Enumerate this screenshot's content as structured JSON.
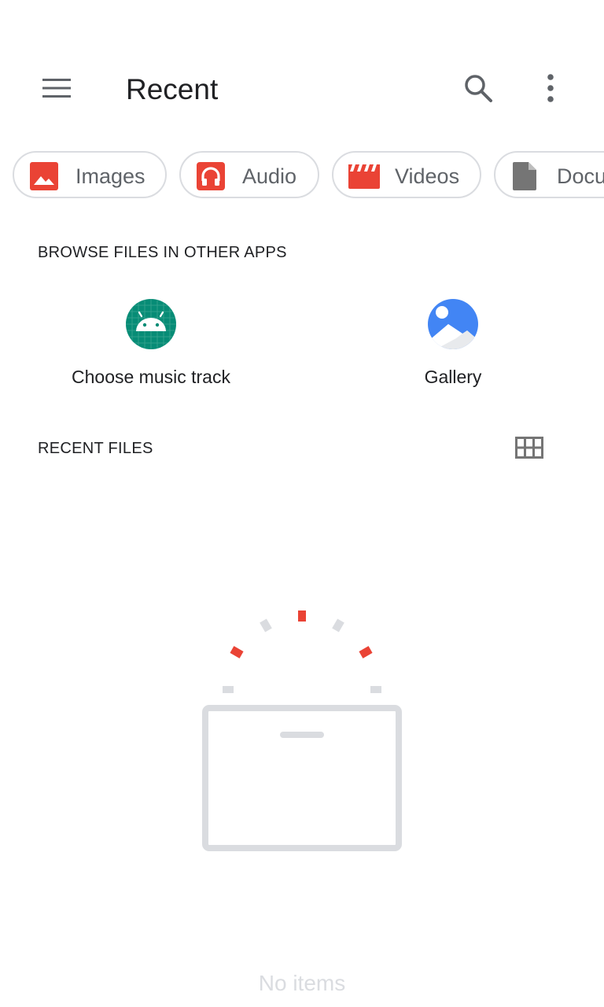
{
  "appbar": {
    "title": "Recent",
    "menu_icon": "hamburger-menu-icon",
    "search_icon": "search-icon",
    "more_icon": "more-vert-icon"
  },
  "chips": [
    {
      "label": "Images",
      "icon": "image-icon",
      "color": "#ea4335"
    },
    {
      "label": "Audio",
      "icon": "headphones-icon",
      "color": "#ea4335"
    },
    {
      "label": "Videos",
      "icon": "movie-clapper-icon",
      "color": "#ea4335"
    },
    {
      "label": "Docu",
      "icon": "document-icon",
      "color": "#5f6368"
    }
  ],
  "browse": {
    "title": "BROWSE FILES IN OTHER APPS",
    "apps": [
      {
        "label": "Choose music track",
        "icon": "android-icon",
        "color": "#078c76"
      },
      {
        "label": "Gallery",
        "icon": "gallery-icon",
        "color": "#4285f4"
      }
    ]
  },
  "recent": {
    "title": "RECENT FILES",
    "view_toggle_icon": "grid-view-icon",
    "empty_text": "No items"
  },
  "colors": {
    "accent_red": "#ea4335",
    "chip_border": "#dadce0",
    "muted_text": "#5f6368",
    "illustration_gray": "#dadce0"
  }
}
